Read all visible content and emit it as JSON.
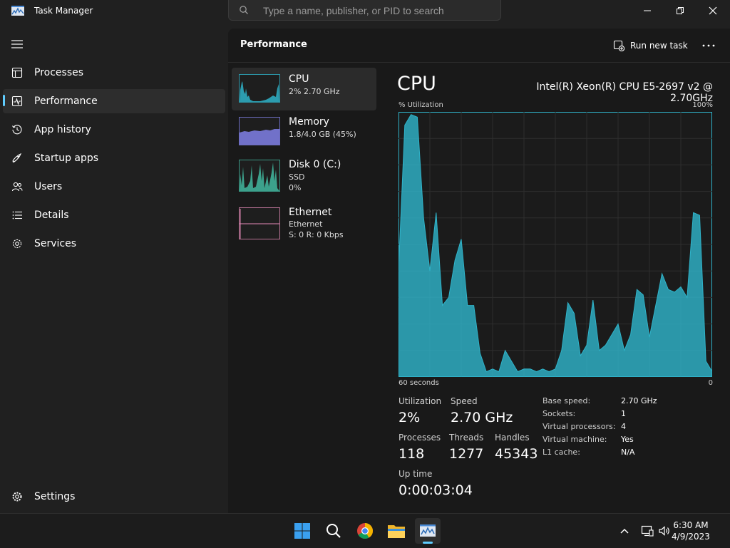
{
  "window": {
    "title": "Task Manager",
    "search_placeholder": "Type a name, publisher, or PID to search"
  },
  "sidebar": {
    "items": [
      {
        "label": "Processes",
        "icon": "processes-icon"
      },
      {
        "label": "Performance",
        "icon": "performance-icon",
        "active": true
      },
      {
        "label": "App history",
        "icon": "history-icon"
      },
      {
        "label": "Startup apps",
        "icon": "startup-icon"
      },
      {
        "label": "Users",
        "icon": "users-icon"
      },
      {
        "label": "Details",
        "icon": "details-icon"
      },
      {
        "label": "Services",
        "icon": "services-icon"
      }
    ],
    "settings_label": "Settings"
  },
  "header": {
    "title": "Performance",
    "run_task_label": "Run new task"
  },
  "resources": [
    {
      "name": "CPU",
      "line1": "2%  2.70 GHz",
      "color": "#2fb3c9"
    },
    {
      "name": "Memory",
      "line1": "1.8/4.0 GB (45%)",
      "color": "#8080e8"
    },
    {
      "name": "Disk 0 (C:)",
      "line1": "SSD",
      "line2": "0%",
      "color": "#42b8a0"
    },
    {
      "name": "Ethernet",
      "line1": "Ethernet",
      "line2": "S: 0 R: 0 Kbps",
      "color": "#e58ab8"
    }
  ],
  "detail": {
    "title": "CPU",
    "model": "Intel(R) Xeon(R) CPU E5-2697 v2 @ 2.70GHz",
    "y_label": "% Utilization",
    "y_max_label": "100%",
    "x_left_label": "60 seconds",
    "x_right_label": "0",
    "stats": {
      "utilization_label": "Utilization",
      "utilization": "2%",
      "speed_label": "Speed",
      "speed": "2.70 GHz",
      "processes_label": "Processes",
      "processes": "118",
      "threads_label": "Threads",
      "threads": "1277",
      "handles_label": "Handles",
      "handles": "45343",
      "uptime_label": "Up time",
      "uptime": "0:00:03:04"
    },
    "specs": [
      {
        "k": "Base speed:",
        "v": "2.70 GHz"
      },
      {
        "k": "Sockets:",
        "v": "1"
      },
      {
        "k": "Virtual processors:",
        "v": "4"
      },
      {
        "k": "Virtual machine:",
        "v": "Yes"
      },
      {
        "k": "L1 cache:",
        "v": "N/A"
      }
    ]
  },
  "chart_data": {
    "type": "area",
    "ylim": [
      0,
      100
    ],
    "x_range_seconds": [
      -60,
      0
    ],
    "color": "#2fb3c9",
    "values": [
      40,
      95,
      99,
      98,
      60,
      40,
      62,
      27,
      30,
      44,
      52,
      27,
      27,
      9,
      2,
      3,
      2,
      10,
      6,
      2,
      3,
      3,
      2,
      3,
      2,
      3,
      10,
      28,
      24,
      8,
      12,
      29,
      10,
      12,
      16,
      20,
      10,
      16,
      33,
      31,
      15,
      27,
      39,
      33,
      32,
      34,
      30,
      62,
      61,
      6,
      2
    ]
  },
  "taskbar": {
    "apps": [
      "start-icon",
      "search-icon",
      "chrome-icon",
      "file-explorer-icon",
      "task-manager-icon"
    ],
    "time": "6:30 AM",
    "date": "4/9/2023"
  }
}
